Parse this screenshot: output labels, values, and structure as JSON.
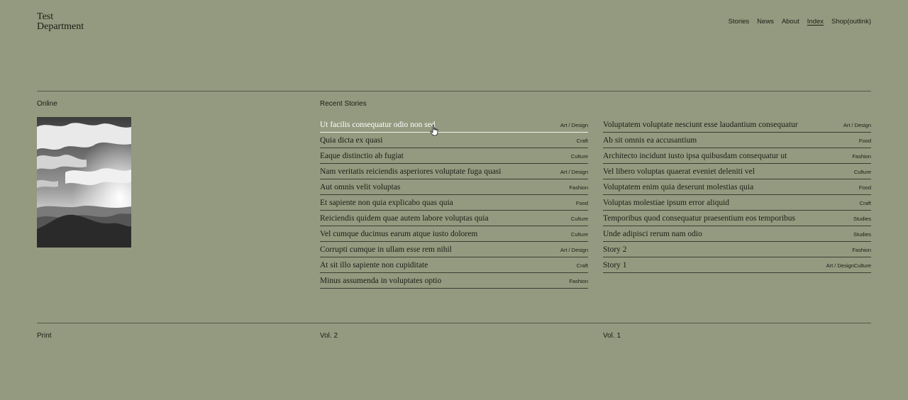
{
  "site": {
    "logo_line1": "Test",
    "logo_line2": "Department"
  },
  "nav": {
    "items": [
      {
        "label": "Stories"
      },
      {
        "label": "News"
      },
      {
        "label": "About"
      },
      {
        "label": "Index",
        "active": true
      },
      {
        "label": "Shop(outlink)"
      }
    ]
  },
  "sections": {
    "online": "Online",
    "recent_stories": "Recent Stories",
    "print": "Print",
    "vol2": "Vol. 2",
    "vol1": "Vol. 1"
  },
  "photo": {
    "icon": "landscape-photo"
  },
  "stories_col1": [
    {
      "title": "Ut facilis consequatur odio non sed",
      "category": "Art / Design",
      "hovered": true
    },
    {
      "title": "Quia dicta ex quasi",
      "category": "Craft"
    },
    {
      "title": "Eaque distinctio ab fugiat",
      "category": "Culture"
    },
    {
      "title": "Nam veritatis reiciendis asperiores voluptate fuga quasi",
      "category": "Art / Design"
    },
    {
      "title": "Aut omnis velit voluptas",
      "category": "Fashion"
    },
    {
      "title": "Et sapiente non quia explicabo quas quia",
      "category": "Food"
    },
    {
      "title": "Reiciendis quidem quae autem labore voluptas quia",
      "category": "Culture"
    },
    {
      "title": "Vel cumque ducimus earum atque iusto dolorem",
      "category": "Culture"
    },
    {
      "title": "Corrupti cumque in ullam esse rem nihil",
      "category": "Art / Design"
    },
    {
      "title": "At sit illo sapiente non cupiditate",
      "category": "Craft"
    },
    {
      "title": "Minus assumenda in voluptates optio",
      "category": "Fashion"
    }
  ],
  "stories_col2": [
    {
      "title": "Voluptatem voluptate nesciunt esse laudantium consequatur",
      "category": "Art / Design"
    },
    {
      "title": "Ab sit omnis ea accusantium",
      "category": "Food"
    },
    {
      "title": "Architecto incidunt iusto ipsa quibusdam consequatur ut",
      "category": "Fashion"
    },
    {
      "title": "Vel libero voluptas quaerat eveniet deleniti vel",
      "category": "Culture"
    },
    {
      "title": "Voluptatem enim quia deserunt molestias quia",
      "category": "Food"
    },
    {
      "title": "Voluptas molestiae ipsum error aliquid",
      "category": "Craft"
    },
    {
      "title": "Temporibus quod consequatur praesentium eos temporibus",
      "category": "Studies"
    },
    {
      "title": "Unde adipisci rerum nam odio",
      "category": "Studies"
    },
    {
      "title": "Story 2",
      "category": "Fashion"
    },
    {
      "title": "Story 1",
      "category": "Art / DesignCulture"
    }
  ]
}
